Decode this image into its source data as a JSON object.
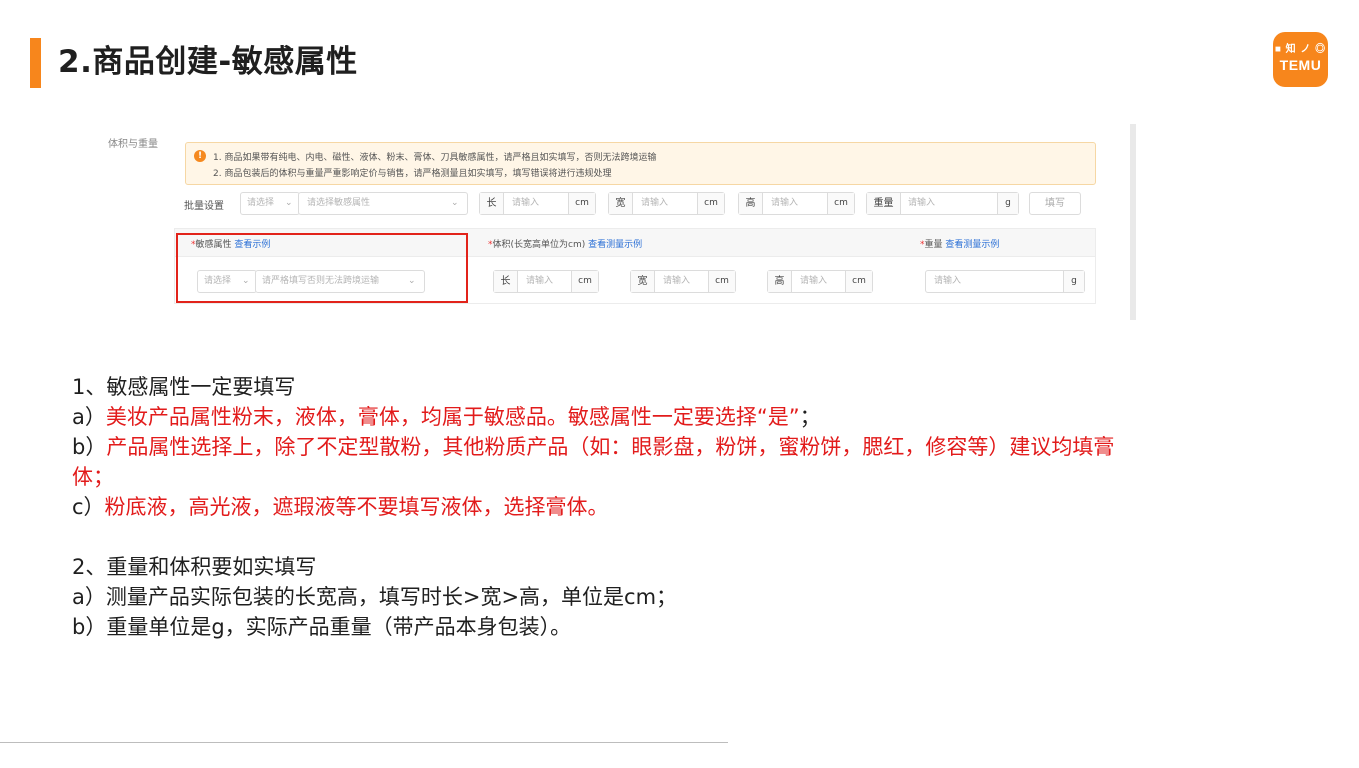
{
  "slide": {
    "title": "2.商品创建-敏感属性",
    "accent_color": "#f7861c"
  },
  "logo": {
    "top": "■ 知 ノ ◎",
    "name": "TEMU",
    "color": "#f7861c"
  },
  "screenshot": {
    "side_label": "体积与重量",
    "alert": {
      "icon": "exclamation-icon",
      "line1": "1. 商品如果带有纯电、内电、磁性、液体、粉末、膏体、刀具敏感属性，请严格且如实填写，否则无法跨境运输",
      "line2": "2. 商品包装后的体积与重量严重影响定价与销售，请严格测量且如实填写，填写错误将进行违规处理"
    },
    "batch": {
      "label": "批量设置",
      "select1": "请选择",
      "select2": "请选择敏感属性",
      "length_prefix": "长",
      "width_prefix": "宽",
      "height_prefix": "高",
      "weight_prefix": "重量",
      "placeholder": "请输入",
      "unit_cm": "cm",
      "unit_g": "g",
      "fill_button": "填写"
    },
    "table": {
      "col1_label": "敏感属性",
      "col1_link": "查看示例",
      "col2_label": "体积(长宽高单位为cm)",
      "col2_link": "查看测量示例",
      "col3_label": "重量",
      "col3_link": "查看测量示例",
      "row_select1": "请选择",
      "row_select2": "请严格填写否则无法跨境运输",
      "placeholder": "请输入",
      "length_prefix": "长",
      "width_prefix": "宽",
      "height_prefix": "高",
      "unit_cm": "cm",
      "unit_g": "g"
    }
  },
  "notes": {
    "s1_heading": "1、敏感属性一定要填写",
    "s1_a_prefix": "a）",
    "s1_a_text": "美妆产品属性粉末，液体，膏体，均属于敏感品。敏感属性一定要选择“是”",
    "s1_a_suffix": "；",
    "s1_b_prefix": "b）",
    "s1_b_text": "产品属性选择上，除了不定型散粉，其他粉质产品（如：眼影盘，粉饼，蜜粉饼，腮红，修容等）建议均填膏体；",
    "s1_c_prefix": "c）",
    "s1_c_text": "粉底液，高光液，遮瑕液等不要填写液体，选择膏体。",
    "s2_heading": "2、重量和体积要如实填写",
    "s2_a": "a）测量产品实际包装的长宽高，填写时长>宽>高，单位是cm；",
    "s2_b": "b）重量单位是g，实际产品重量（带产品本身包装）。"
  }
}
